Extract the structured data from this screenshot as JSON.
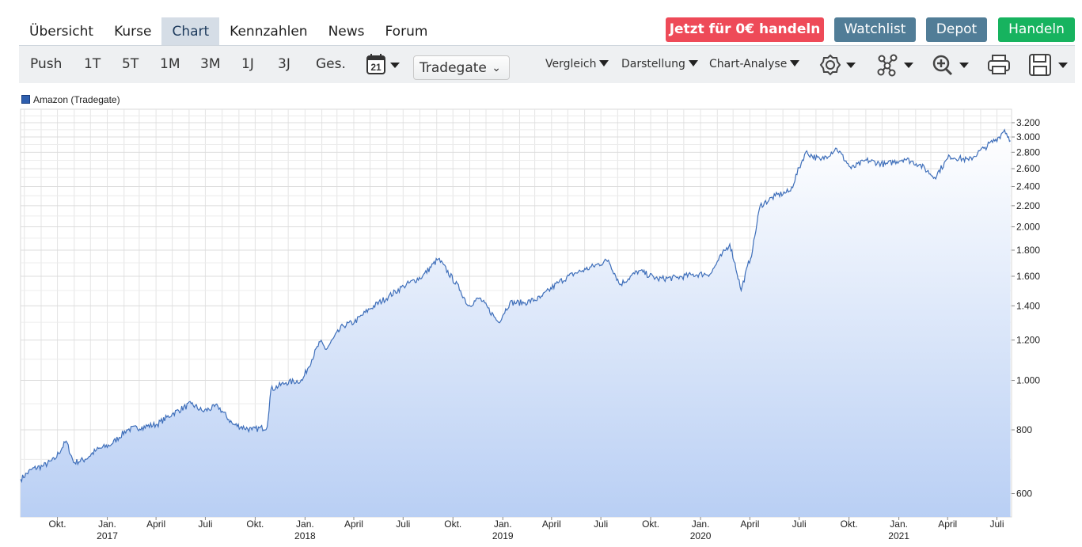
{
  "nav": {
    "tabs": [
      "Übersicht",
      "Kurse",
      "Chart",
      "Kennzahlen",
      "News",
      "Forum"
    ],
    "active": "Chart"
  },
  "actions": {
    "trade_free": "Jetzt für 0€ handeln",
    "watchlist": "Watchlist",
    "depot": "Depot",
    "handeln": "Handeln",
    "colors": {
      "trade_free": "#ee4a58",
      "watchlist": "#517d97",
      "depot": "#517d97",
      "handeln": "#17b35f"
    }
  },
  "toolbar": {
    "ranges": [
      "Push",
      "1T",
      "5T",
      "1M",
      "3M",
      "1J",
      "3J",
      "Ges."
    ],
    "calendar_day": "21",
    "exchange": "Tradegate",
    "vergleich": "Vergleich",
    "darstellung": "Darstellung",
    "chart_analyse": "Chart-Analyse",
    "icons": [
      "gear-icon",
      "network-icon",
      "zoom-in-icon",
      "print-icon",
      "save-icon"
    ]
  },
  "chart_data": {
    "type": "area",
    "scale": "log",
    "series": [
      {
        "name": "Amazon (Tradegate)",
        "color": "#3f6fba"
      }
    ],
    "x": [
      "2016-07-25",
      "2016-08-15",
      "2016-09-05",
      "2016-09-26",
      "2016-10-17",
      "2016-10-31",
      "2016-11-21",
      "2016-12-12",
      "2017-01-09",
      "2017-02-06",
      "2017-03-06",
      "2017-04-03",
      "2017-05-01",
      "2017-06-05",
      "2017-06-26",
      "2017-07-24",
      "2017-08-21",
      "2017-09-25",
      "2017-10-23",
      "2017-10-30",
      "2017-11-27",
      "2017-12-27",
      "2018-01-29",
      "2018-02-09",
      "2018-03-12",
      "2018-04-02",
      "2018-04-30",
      "2018-06-04",
      "2018-07-02",
      "2018-08-06",
      "2018-09-04",
      "2018-10-15",
      "2018-10-29",
      "2018-11-19",
      "2018-12-24",
      "2019-01-14",
      "2019-02-11",
      "2019-03-11",
      "2019-04-15",
      "2019-05-13",
      "2019-06-03",
      "2019-07-15",
      "2019-08-05",
      "2019-09-09",
      "2019-10-14",
      "2019-11-18",
      "2019-12-16",
      "2020-01-20",
      "2020-02-03",
      "2020-02-24",
      "2020-03-16",
      "2020-04-06",
      "2020-04-20",
      "2020-05-18",
      "2020-06-15",
      "2020-07-13",
      "2020-08-10",
      "2020-09-08",
      "2020-10-05",
      "2020-11-02",
      "2020-12-07",
      "2021-01-11",
      "2021-02-08",
      "2021-03-08",
      "2021-04-05",
      "2021-05-10",
      "2021-06-07",
      "2021-07-05",
      "2021-07-15",
      "2021-07-26"
    ],
    "values": [
      640,
      670,
      680,
      700,
      760,
      690,
      700,
      730,
      750,
      800,
      810,
      820,
      860,
      900,
      870,
      890,
      820,
      800,
      810,
      960,
      990,
      1000,
      1190,
      1150,
      1280,
      1300,
      1380,
      1460,
      1530,
      1600,
      1730,
      1500,
      1400,
      1450,
      1300,
      1420,
      1420,
      1450,
      1560,
      1620,
      1650,
      1720,
      1540,
      1640,
      1580,
      1590,
      1610,
      1620,
      1720,
      1850,
      1500,
      1800,
      2200,
      2300,
      2350,
      2800,
      2700,
      2850,
      2600,
      2700,
      2650,
      2720,
      2650,
      2500,
      2750,
      2700,
      2850,
      3000,
      3100,
      2950
    ],
    "y_ticks": [
      "600",
      "800",
      "1.000",
      "1.200",
      "1.400",
      "1.600",
      "1.800",
      "2.000",
      "2.200",
      "2.400",
      "2.600",
      "2.800",
      "3.000",
      "3.200"
    ],
    "x_ticks": [
      {
        "label": "Okt.",
        "sub": ""
      },
      {
        "label": "Jan.",
        "sub": "2017"
      },
      {
        "label": "April",
        "sub": ""
      },
      {
        "label": "Juli",
        "sub": ""
      },
      {
        "label": "Okt.",
        "sub": ""
      },
      {
        "label": "Jan.",
        "sub": "2018"
      },
      {
        "label": "April",
        "sub": ""
      },
      {
        "label": "Juli",
        "sub": ""
      },
      {
        "label": "Okt.",
        "sub": ""
      },
      {
        "label": "Jan.",
        "sub": "2019"
      },
      {
        "label": "April",
        "sub": ""
      },
      {
        "label": "Juli",
        "sub": ""
      },
      {
        "label": "Okt.",
        "sub": ""
      },
      {
        "label": "Jan.",
        "sub": "2020"
      },
      {
        "label": "April",
        "sub": ""
      },
      {
        "label": "Juli",
        "sub": ""
      },
      {
        "label": "Okt.",
        "sub": ""
      },
      {
        "label": "Jan.",
        "sub": "2021"
      },
      {
        "label": "April",
        "sub": ""
      },
      {
        "label": "Juli",
        "sub": ""
      }
    ],
    "x_tick_dates": [
      "2016-10-01",
      "2017-01-01",
      "2017-04-01",
      "2017-07-01",
      "2017-10-01",
      "2018-01-01",
      "2018-04-01",
      "2018-07-01",
      "2018-10-01",
      "2019-01-01",
      "2019-04-01",
      "2019-07-01",
      "2019-10-01",
      "2020-01-01",
      "2020-04-01",
      "2020-07-01",
      "2020-10-01",
      "2021-01-01",
      "2021-04-01",
      "2021-07-01"
    ],
    "ylim": [
      540,
      3400
    ],
    "xlim": [
      "2016-07-25",
      "2021-07-28"
    ],
    "grid": true,
    "legend": "top-left"
  }
}
